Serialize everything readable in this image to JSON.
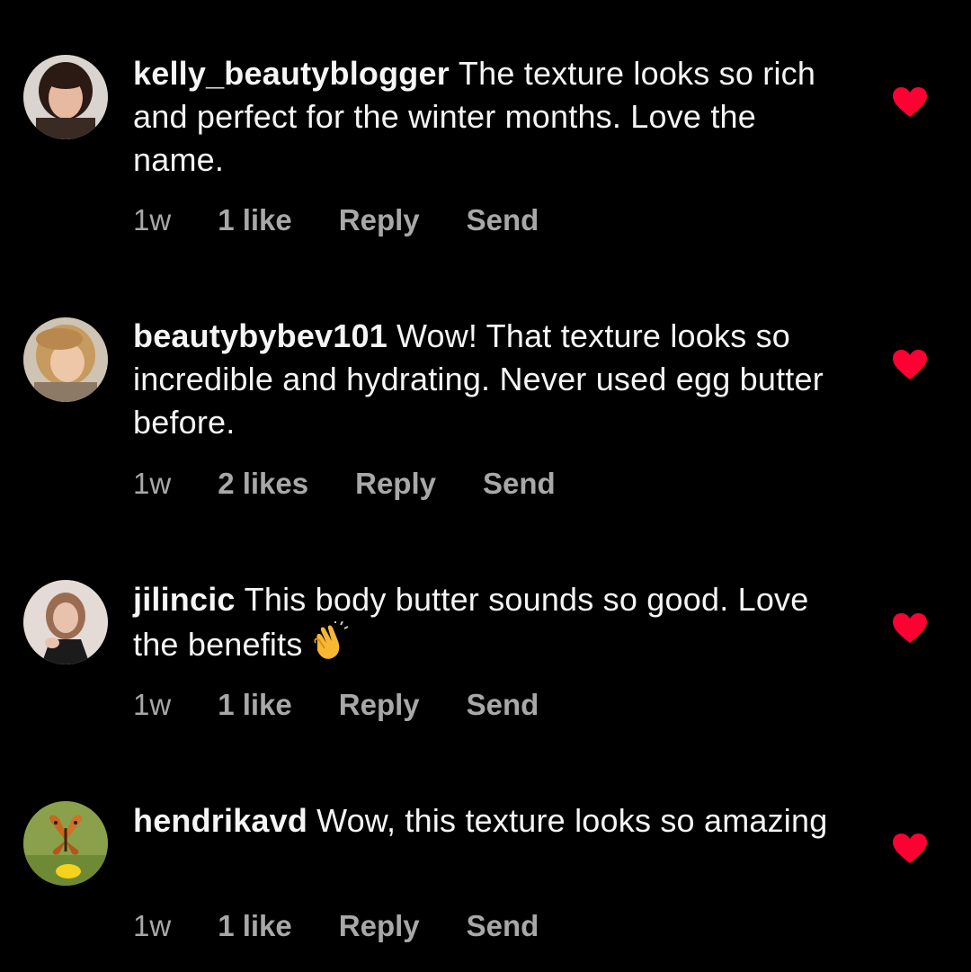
{
  "colors": {
    "background": "#000000",
    "text": "#f5f5f5",
    "meta_text": "#a8a8a8",
    "like_heart": "#ff0033"
  },
  "comments": [
    {
      "username": "kelly_beautyblogger",
      "text": "The texture looks so rich and perfect for the winter months. Love the name.",
      "time": "1w",
      "likes": "1 like",
      "reply_label": "Reply",
      "send_label": "Send",
      "liked": true,
      "avatar_icon": "avatar-photo"
    },
    {
      "username": "beautybybev101",
      "text": "Wow! That texture looks so incredible and hydrating. Never used egg butter before.",
      "time": "1w",
      "likes": "2 likes",
      "reply_label": "Reply",
      "send_label": "Send",
      "liked": true,
      "avatar_icon": "avatar-photo"
    },
    {
      "username": "jilincic",
      "text": "This body butter sounds so good. Love the benefits",
      "emoji": "clapping-hands-emoji",
      "time": "1w",
      "likes": "1 like",
      "reply_label": "Reply",
      "send_label": "Send",
      "liked": true,
      "avatar_icon": "avatar-photo"
    },
    {
      "username": "hendrikavd",
      "text": "Wow, this texture looks so amazing",
      "time": "1w",
      "likes": "1 like",
      "reply_label": "Reply",
      "send_label": "Send",
      "liked": true,
      "avatar_icon": "avatar-photo-butterfly"
    }
  ]
}
